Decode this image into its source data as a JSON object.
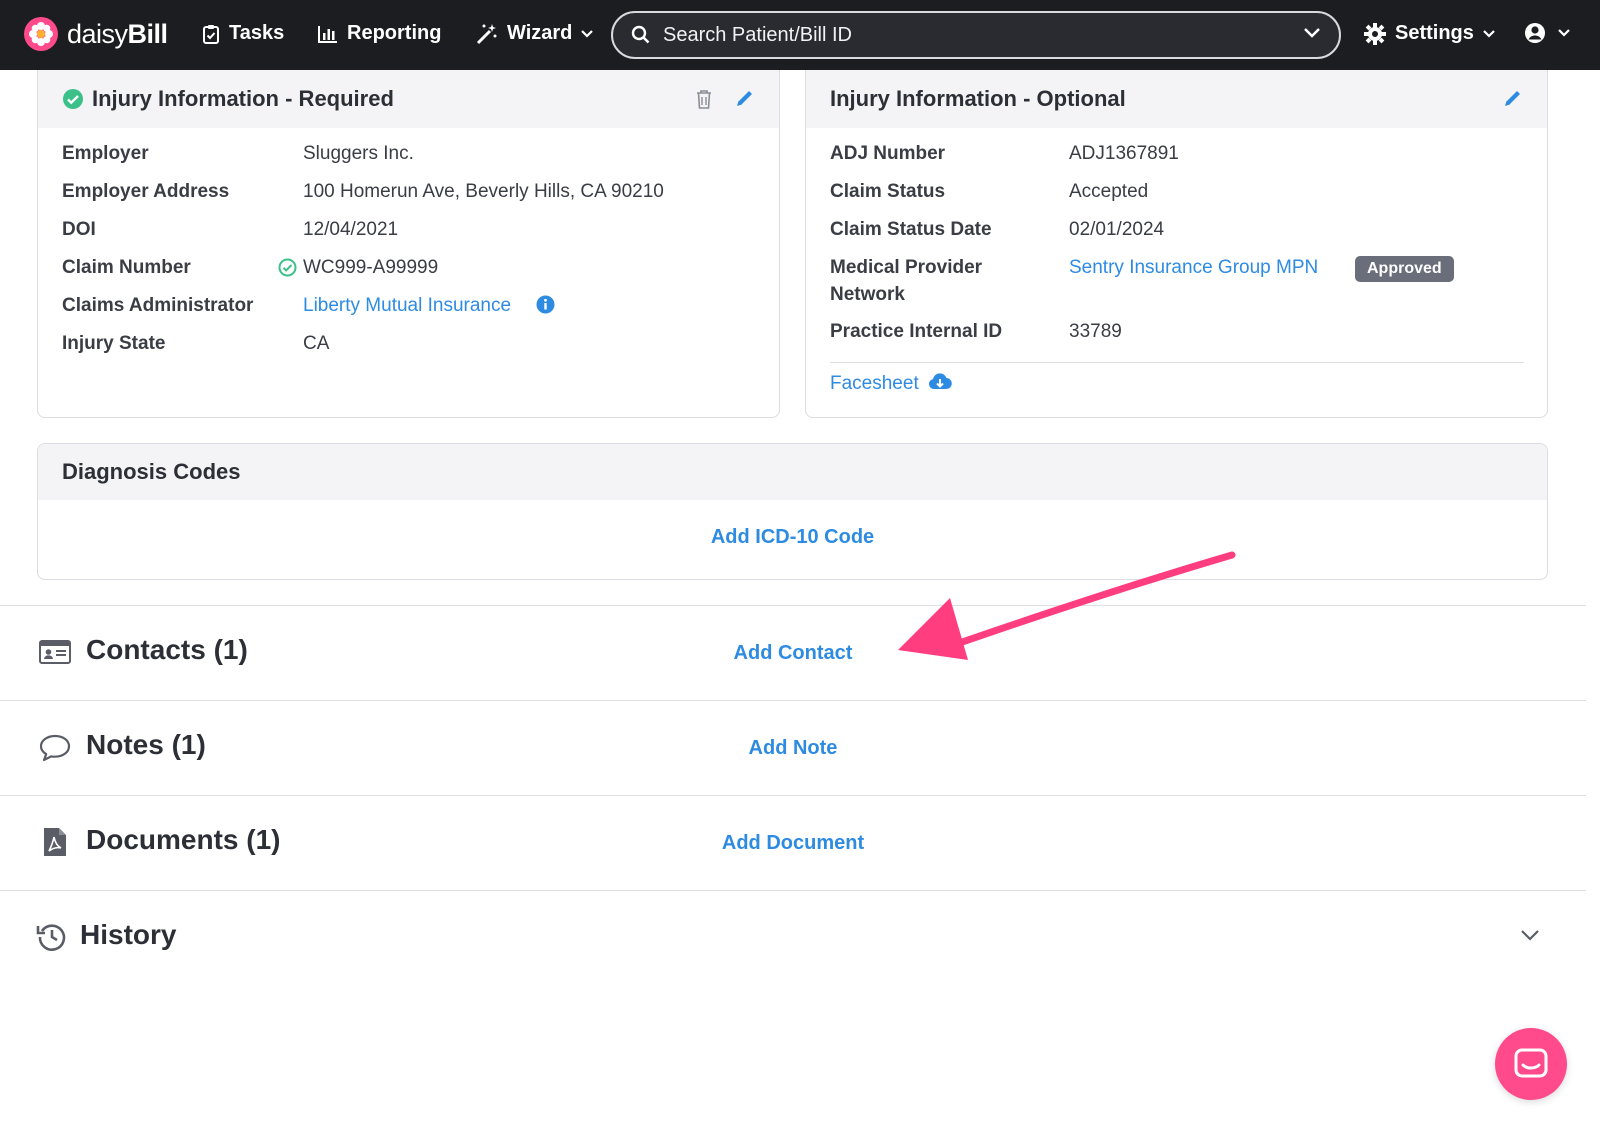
{
  "app": {
    "brand_light": "daisy",
    "brand_bold": "Bill"
  },
  "nav": {
    "tasks": "Tasks",
    "reporting": "Reporting",
    "wizard": "Wizard",
    "settings": "Settings"
  },
  "search": {
    "placeholder": "Search Patient/Bill ID"
  },
  "injury_required": {
    "title": "Injury Information - Required",
    "rows": [
      {
        "label": "Employer",
        "value": "Sluggers Inc."
      },
      {
        "label": "Employer Address",
        "value": "100 Homerun Ave, Beverly Hills, CA 90210"
      },
      {
        "label": "DOI",
        "value": "12/04/2021"
      },
      {
        "label": "Claim Number",
        "value": "WC999-A99999"
      },
      {
        "label": "Claims Administrator",
        "value": "Liberty Mutual Insurance"
      },
      {
        "label": "Injury State",
        "value": "CA"
      }
    ]
  },
  "injury_optional": {
    "title": "Injury Information - Optional",
    "rows": [
      {
        "label": "ADJ Number",
        "value": "ADJ1367891"
      },
      {
        "label": "Claim Status",
        "value": "Accepted"
      },
      {
        "label": "Claim Status Date",
        "value": "02/01/2024"
      },
      {
        "label": "Medical Provider Network",
        "value": "Sentry Insurance Group MPN",
        "badge": "Approved"
      },
      {
        "label": "Practice Internal ID",
        "value": "33789"
      }
    ],
    "facesheet": "Facesheet"
  },
  "diagnosis": {
    "title": "Diagnosis Codes",
    "action": "Add ICD-10 Code"
  },
  "sections": {
    "contacts": {
      "title": "Contacts (1)",
      "action": "Add Contact"
    },
    "notes": {
      "title": "Notes (1)",
      "action": "Add Note"
    },
    "documents": {
      "title": "Documents (1)",
      "action": "Add Document"
    },
    "history": {
      "title": "History"
    }
  },
  "colors": {
    "accent": "#2e8be2",
    "brand": "#ff4b8b",
    "topbar": "#1c1d21",
    "success": "#3cc08a",
    "arrow": "#ff3d7f"
  }
}
